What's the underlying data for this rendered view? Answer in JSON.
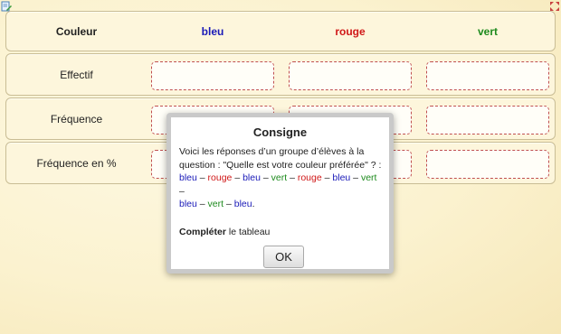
{
  "icons": {
    "top_left": "edit-document-icon",
    "top_right": "fullscreen-icon"
  },
  "colors": {
    "blue": "#1a1ab8",
    "red": "#d01818",
    "green": "#1d8a1d"
  },
  "table": {
    "header_label": "Couleur",
    "columns": [
      "bleu",
      "rouge",
      "vert"
    ],
    "rows": [
      {
        "label": "Effectif"
      },
      {
        "label": "Fréquence"
      },
      {
        "label": "Fréquence en %"
      }
    ]
  },
  "dialog": {
    "title": "Consigne",
    "text_line1": "Voici les réponses d’un groupe d’élèves à la",
    "text_line2": "question : \"Quelle est votre couleur préférée\" ? :",
    "responses": [
      "bleu",
      "rouge",
      "bleu",
      "vert",
      "rouge",
      "bleu",
      "vert",
      "bleu",
      "vert",
      "bleu"
    ],
    "instruction_bold": "Compléter",
    "instruction_rest": " le tableau",
    "ok_label": "OK"
  }
}
